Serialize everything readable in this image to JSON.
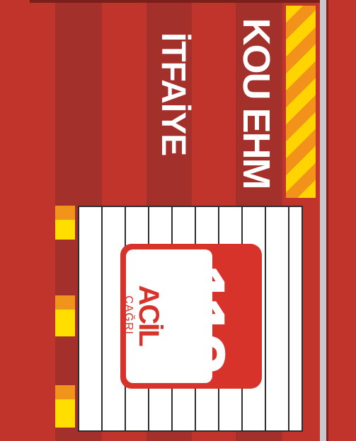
{
  "sign": {
    "unit_name": "KOU EHM",
    "department": "İTFAİYE",
    "emergency_number": "112",
    "emergency_label": "ACİL",
    "emergency_sublabel": "ÇAĞRI"
  },
  "colors": {
    "truck_red": "#c0342b",
    "stripe_dark": "#a3302b",
    "hazard_yellow": "#ffd400",
    "hazard_orange": "#f3921a",
    "logo_red": "#d8332b"
  }
}
